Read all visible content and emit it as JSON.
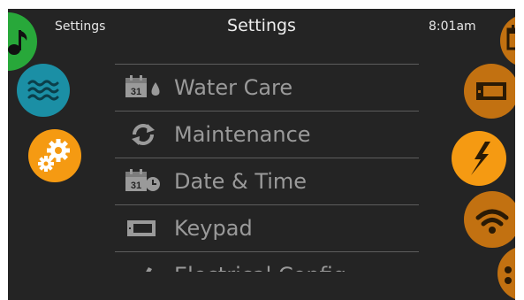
{
  "header": {
    "left_label": "Settings",
    "title": "Settings",
    "time": "8:01am"
  },
  "colors": {
    "background": "#242424",
    "orange": "#f59a12",
    "dark_orange": "#c27111",
    "teal": "#1b8fa5",
    "green": "#28a83a",
    "menu_text": "#9a9a9a",
    "header_text": "#e6e6e6"
  },
  "left_nav": [
    {
      "name": "music",
      "icon": "music-note-icon",
      "color": "#28a83a"
    },
    {
      "name": "water",
      "icon": "water-waves-icon",
      "color": "#1b8fa5"
    },
    {
      "name": "settings",
      "icon": "gears-icon",
      "color": "#f59a12",
      "active": true
    }
  ],
  "right_nav": [
    {
      "name": "calendar",
      "icon": "calendar-icon",
      "color": "#c27111"
    },
    {
      "name": "keypad",
      "icon": "keypad-icon",
      "color": "#c27111"
    },
    {
      "name": "electrical",
      "icon": "lightning-bolt-icon",
      "color": "#f59a12",
      "active": true
    },
    {
      "name": "wifi",
      "icon": "wifi-icon",
      "color": "#c27111"
    },
    {
      "name": "more",
      "icon": "more-dots-icon",
      "color": "#c27111"
    }
  ],
  "menu": {
    "items": [
      {
        "label": "Water Care",
        "icon": "calendar-drop-icon"
      },
      {
        "label": "Maintenance",
        "icon": "recycle-arrows-icon"
      },
      {
        "label": "Date & Time",
        "icon": "calendar-clock-icon"
      },
      {
        "label": "Keypad",
        "icon": "keypad-icon"
      },
      {
        "label": "Electrical Config",
        "icon": "pen-icon"
      }
    ]
  }
}
